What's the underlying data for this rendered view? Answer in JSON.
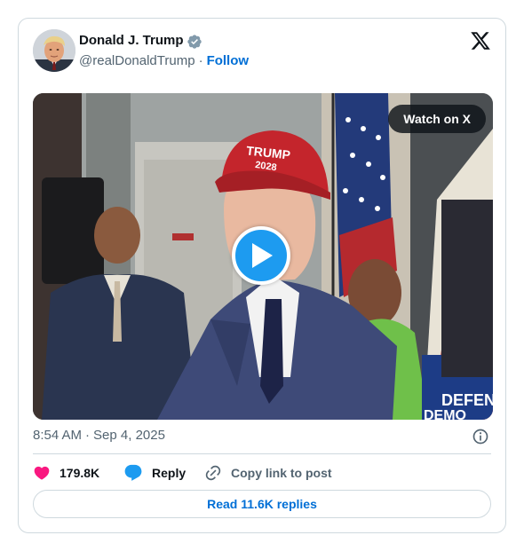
{
  "author": {
    "name": "Donald J. Trump",
    "handle": "@realDonaldTrump",
    "separator": "·",
    "follow_label": "Follow",
    "verified": true
  },
  "icons": {
    "verified": "verified-badge-icon",
    "brand": "x-logo-icon",
    "play": "play-icon",
    "info": "info-icon",
    "like": "heart-icon",
    "reply": "speech-bubble-icon",
    "copy": "link-icon"
  },
  "media": {
    "watch_label": "Watch on X",
    "hat_text_line1": "TRUMP",
    "hat_text_line2": "2028",
    "sign_text_line1": "DEFEN",
    "sign_text_line2": "DEMO"
  },
  "meta": {
    "time": "8:54 AM",
    "separator": "·",
    "date": "Sep 4, 2025"
  },
  "actions": {
    "likes": "179.8K",
    "reply_label": "Reply",
    "copy_label": "Copy link to post"
  },
  "footer": {
    "read_replies_label": "Read 11.6K replies"
  },
  "colors": {
    "link_blue": "#006fd6",
    "play_blue": "#1d9bf0",
    "like_pink": "#f91880",
    "verified_gray": "#829aab",
    "muted_text": "#536471",
    "border": "#cfd9de"
  }
}
